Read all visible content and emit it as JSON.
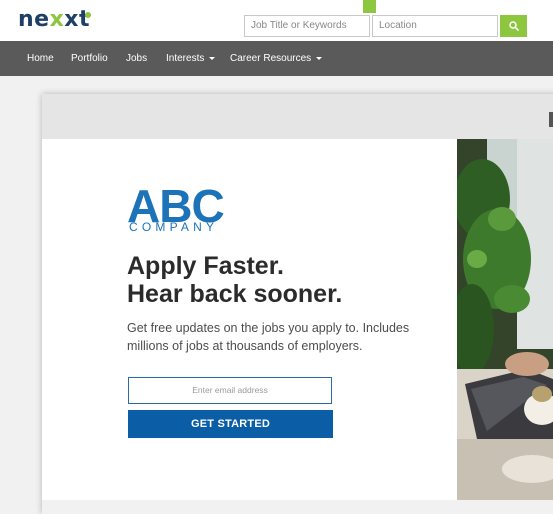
{
  "header": {
    "logo_part1": "ne",
    "logo_part2": "x",
    "logo_part3": "xt",
    "keywords_placeholder": "Job Title or Keywords",
    "location_placeholder": "Location",
    "search_icon": "search-icon",
    "accent_color": "#8dc63f",
    "brand_color": "#1f3f67"
  },
  "nav": {
    "items": [
      {
        "label": "Home"
      },
      {
        "label": "Portfolio"
      },
      {
        "label": "Jobs"
      },
      {
        "label": "Interests"
      },
      {
        "label": "Career Resources"
      }
    ],
    "bg_color": "#5a5a5a"
  },
  "promo": {
    "brand_main": "ABC",
    "brand_sub": "COMPANY",
    "headline_line1": "Apply Faster.",
    "headline_line2": "Hear back sooner.",
    "body": "Get free updates on the jobs you apply to. Includes millions of jobs at thousands of employers.",
    "email_placeholder": "Enter email address",
    "cta_label": "GET STARTED",
    "brand_color": "#1d73b8",
    "cta_color": "#0b5ea6"
  }
}
